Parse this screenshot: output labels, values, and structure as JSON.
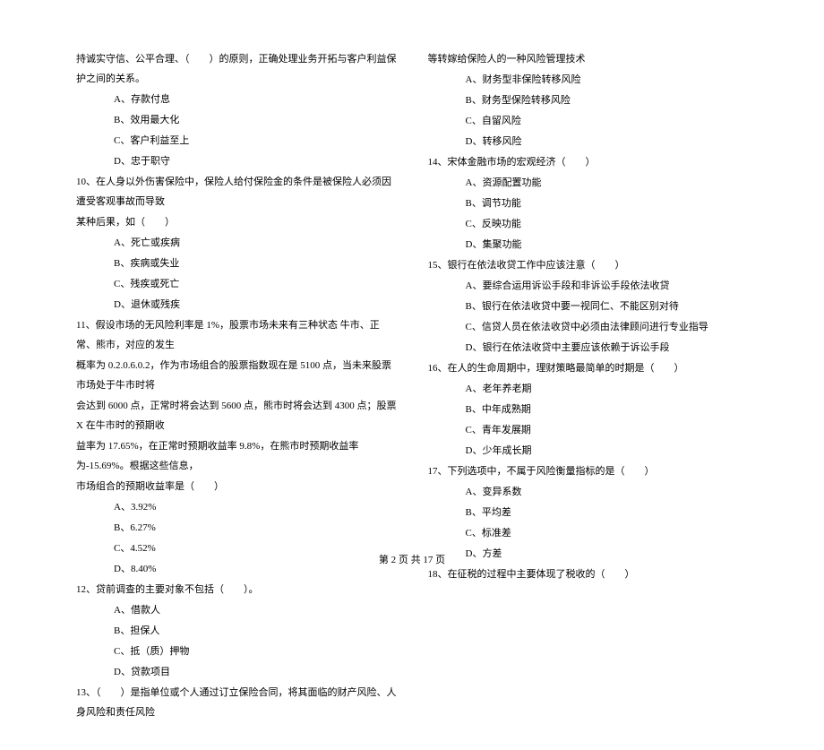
{
  "left_column": {
    "q_intro": "持诚实守信、公平合理、（　　）的原则，正确处理业务开拓与客户利益保护之间的关系。",
    "q_intro_options": {
      "a": "A、存款付息",
      "b": "B、效用最大化",
      "c": "C、客户利益至上",
      "d": "D、忠于职守"
    },
    "q10": "10、在人身以外伤害保险中，保险人给付保险金的条件是被保险人必须因遭受客观事故而导致",
    "q10_cont": "某种后果，如（　　）",
    "q10_options": {
      "a": "A、死亡或疾病",
      "b": "B、疾病或失业",
      "c": "C、残疾或死亡",
      "d": "D、退休或残疾"
    },
    "q11": "11、假设市场的无风险利率是 1%，股票市场未来有三种状态  牛市、正常、熊市，对应的发生",
    "q11_cont1": "概率为 0.2.0.6.0.2，作为市场组合的股票指数现在是 5100 点，当未来股票市场处于牛市时将",
    "q11_cont2": "会达到 6000 点，正常时将会达到 5600 点，熊市时将会达到 4300 点；股票 X 在牛市时的预期收",
    "q11_cont3": "益率为 17.65%，在正常时预期收益率 9.8%，在熊市时预期收益率为-15.69%。根据这些信息，",
    "q11_cont4": "市场组合的预期收益率是（　　）",
    "q11_options": {
      "a": "A、3.92%",
      "b": "B、6.27%",
      "c": "C、4.52%",
      "d": "D、8.40%"
    },
    "q12": "12、贷前调查的主要对象不包括（　　）。",
    "q12_options": {
      "a": "A、借款人",
      "b": "B、担保人",
      "c": "C、抵（质）押物",
      "d": "D、贷款项目"
    },
    "q13": "13、（　　）是指单位或个人通过订立保险合同，将其面临的财产风险、人身风险和责任风险"
  },
  "right_column": {
    "q13_cont": "等转嫁给保险人的一种风险管理技术",
    "q13_options": {
      "a": "A、财务型非保险转移风险",
      "b": "B、财务型保险转移风险",
      "c": "C、自留风险",
      "d": "D、转移风险"
    },
    "q14": "14、宋体金融市场的宏观经济（　　）",
    "q14_options": {
      "a": "A、资源配置功能",
      "b": "B、调节功能",
      "c": "C、反映功能",
      "d": "D、集聚功能"
    },
    "q15": "15、银行在依法收贷工作中应该注意（　　）",
    "q15_options": {
      "a": "A、要综合运用诉讼手段和非诉讼手段依法收贷",
      "b": "B、银行在依法收贷中要一视同仁、不能区别对待",
      "c": "C、信贷人员在依法收贷中必须由法律顾问进行专业指导",
      "d": "D、银行在依法收贷中主要应该依赖于诉讼手段"
    },
    "q16": "16、在人的生命周期中，理财策略最简单的时期是（　　）",
    "q16_options": {
      "a": "A、老年养老期",
      "b": "B、中年成熟期",
      "c": "C、青年发展期",
      "d": "D、少年成长期"
    },
    "q17": "17、下列选项中，不属于风险衡量指标的是（　　）",
    "q17_options": {
      "a": "A、变异系数",
      "b": "B、平均差",
      "c": "C、标准差",
      "d": "D、方差"
    },
    "q18": "18、在征税的过程中主要体现了税收的（　　）"
  },
  "footer": "第 2 页 共 17 页"
}
